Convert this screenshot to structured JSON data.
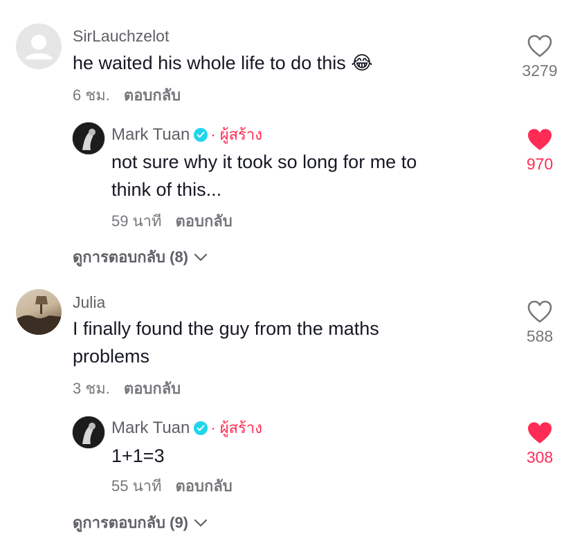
{
  "comments": [
    {
      "username": "SirLauchzelot",
      "text": "he waited his whole life to do this 😂",
      "time": "6 ชม.",
      "reply_label": "ตอบกลับ",
      "likes": "3279",
      "liked": false,
      "avatar_icon": "default-user-icon",
      "reply": {
        "username": "Mark Tuan",
        "creator_tag": "ผู้สร้าง",
        "dot": "·",
        "text_lines": [
          "not sure why it took so long for me to",
          "think of this..."
        ],
        "time": "59 นาที",
        "reply_label": "ตอบกลับ",
        "likes": "970",
        "liked": true
      },
      "view_replies": "ดูการตอบกลับ (8)"
    },
    {
      "username": "Julia",
      "text_lines": [
        "I finally found the guy from the maths",
        "problems"
      ],
      "time": "3 ชม.",
      "reply_label": "ตอบกลับ",
      "likes": "588",
      "liked": false,
      "reply": {
        "username": "Mark Tuan",
        "creator_tag": "ผู้สร้าง",
        "dot": "·",
        "text_lines": [
          "1+1=3"
        ],
        "time": "55 นาที",
        "reply_label": "ตอบกลับ",
        "likes": "308",
        "liked": true
      },
      "view_replies": "ดูการตอบกลับ (9)"
    }
  ],
  "colors": {
    "accent": "#fe2c55",
    "verified": "#20d5ec",
    "meta_text": "#76777b",
    "username": "#5f6066"
  }
}
